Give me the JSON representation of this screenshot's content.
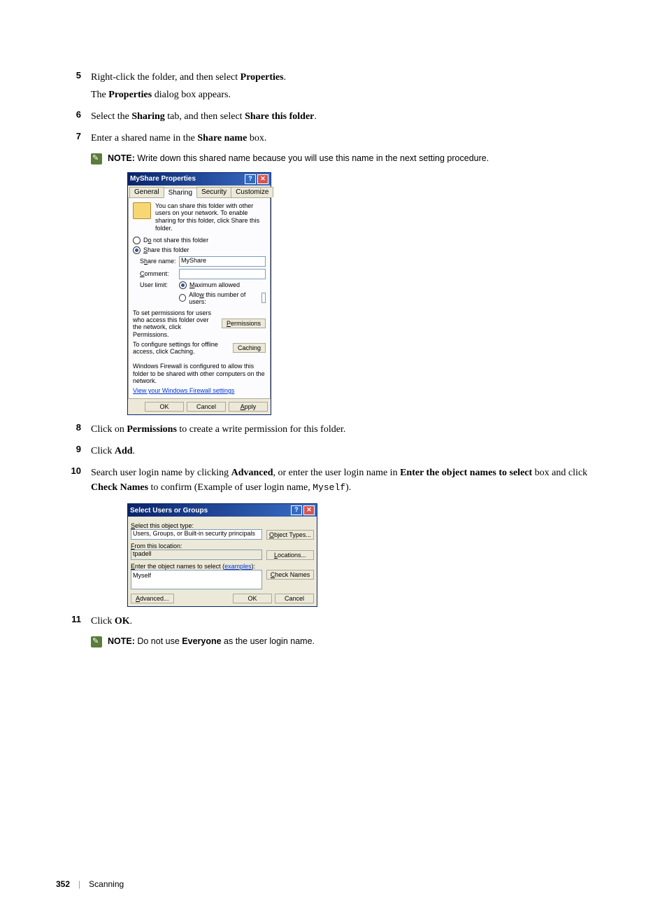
{
  "steps": {
    "s5": {
      "num": "5",
      "line1a": "Right-click the folder, and then select ",
      "line1b": "Properties",
      "line1c": ".",
      "line2a": "The ",
      "line2b": "Properties",
      "line2c": " dialog box appears."
    },
    "s6": {
      "num": "6",
      "a": "Select the ",
      "b": "Sharing",
      "c": " tab, and then select ",
      "d": "Share this folder",
      "e": "."
    },
    "s7": {
      "num": "7",
      "a": "Enter a shared name in the ",
      "b": "Share name",
      "c": " box."
    },
    "s8": {
      "num": "8",
      "a": "Click on ",
      "b": "Permissions",
      "c": " to create a write permission for this folder."
    },
    "s9": {
      "num": "9",
      "a": "Click ",
      "b": "Add",
      "c": "."
    },
    "s10": {
      "num": "10",
      "a": "Search user login name by clicking ",
      "b": "Advanced",
      "c": ", or enter the user login name in ",
      "d": "Enter the object names to select",
      "e": " box and click ",
      "f": "Check Names",
      "g": " to confirm (Example of user login name, ",
      "h": "Myself",
      "i": ")."
    },
    "s11": {
      "num": "11",
      "a": "Click ",
      "b": "OK",
      "c": "."
    }
  },
  "notes": {
    "n1": {
      "label": "NOTE: ",
      "text": "Write down this shared name because you will use this name in the next setting procedure."
    },
    "n2": {
      "label": "NOTE: ",
      "a": "Do not use ",
      "b": "Everyone",
      "c": " as the user login name."
    }
  },
  "dialog1": {
    "title": "MyShare Properties",
    "help": "?",
    "close": "✕",
    "tabs": {
      "general": "General",
      "sharing": "Sharing",
      "security": "Security",
      "customize": "Customize"
    },
    "info": "You can share this folder with other users on your network. To enable sharing for this folder, click Share this folder.",
    "radio_no": "Do not share this folder",
    "radio_yes": "Share this folder",
    "share_name_lbl": "Share name:",
    "share_name_val": "MyShare",
    "comment_lbl": "Comment:",
    "userlimit_lbl": "User limit:",
    "max": "Maximum allowed",
    "allow": "Allow this number of users:",
    "perm_text": "To set permissions for users who access this folder over the network, click Permissions.",
    "perm_btn": "Permissions",
    "cache_text": "To configure settings for offline access, click Caching.",
    "cache_btn": "Caching",
    "fw": "Windows Firewall is configured to allow this folder to be shared with other computers on the network.",
    "fw_link": "View your Windows Firewall settings",
    "ok": "OK",
    "cancel": "Cancel",
    "apply": "Apply"
  },
  "dialog2": {
    "title": "Select Users or Groups",
    "help": "?",
    "close": "✕",
    "obj_type_lbl": "Select this object type:",
    "obj_type_val": "Users, Groups, or Built-in security principals",
    "obj_type_btn": "Object Types...",
    "loc_lbl": "From this location:",
    "loc_val": "tpadell",
    "loc_btn": "Locations...",
    "names_lbl_a": "Enter the object names to select (",
    "names_lbl_b": "examples",
    "names_lbl_c": "):",
    "names_val": "Myself",
    "check_btn": "Check Names",
    "adv_btn": "Advanced...",
    "ok": "OK",
    "cancel": "Cancel"
  },
  "footer": {
    "page": "352",
    "section": "Scanning"
  }
}
